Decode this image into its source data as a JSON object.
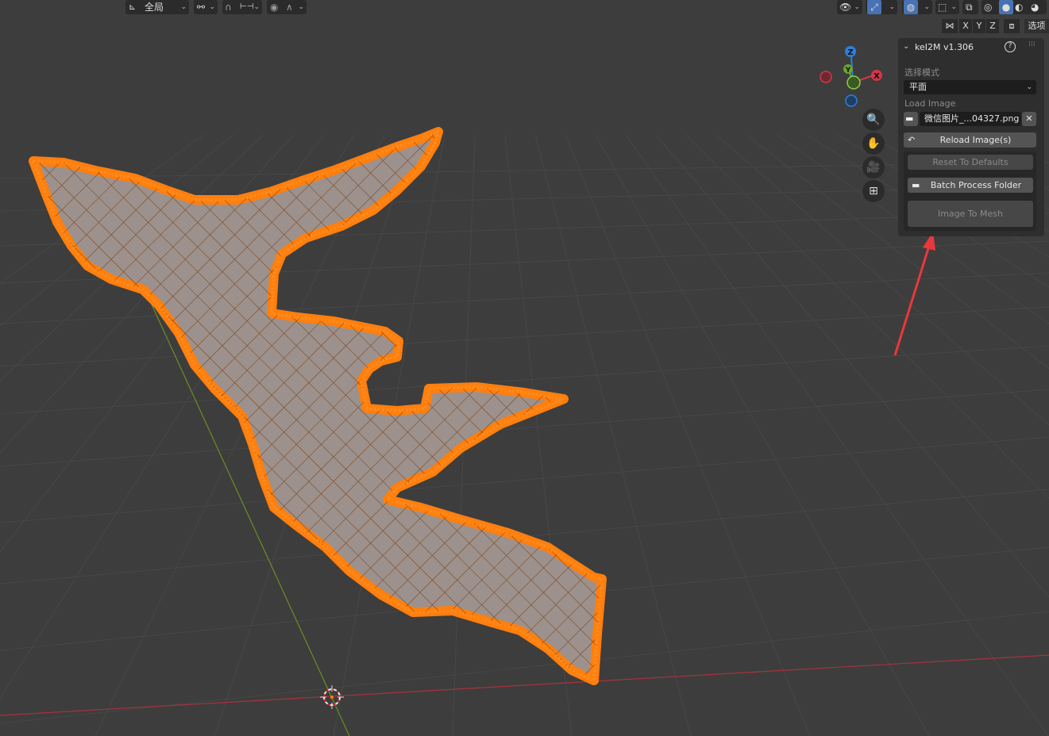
{
  "header": {
    "transform_orientation": "全局",
    "options_tab": "选项"
  },
  "axes": [
    "X",
    "Y",
    "Z"
  ],
  "gizmo": {
    "x": "X",
    "y": "Y",
    "z": "Z"
  },
  "colors": {
    "background": "#3d3d3d",
    "mesh_outline": "#ff7f0e",
    "mesh_fill": "#9c918c",
    "x_axis": "#c23b46",
    "y_axis": "#6b8e23",
    "annotation_arrow": "#e8383d"
  },
  "panel": {
    "title": "keI2M v1.306",
    "select_mode_label": "选择模式",
    "select_mode_value": "平面",
    "load_image_label": "Load Image",
    "image_file": "微信图片_...04327.png",
    "reload_button": "Reload Image(s)",
    "reset_button": "Reset To Defaults",
    "batch_button": "Batch Process Folder",
    "image_to_mesh_button": "Image To Mesh"
  }
}
